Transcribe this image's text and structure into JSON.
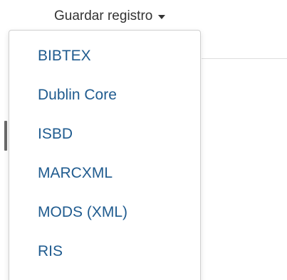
{
  "dropdown": {
    "toggle_label": "Guardar registro",
    "items": [
      {
        "label": "BIBTEX"
      },
      {
        "label": "Dublin Core"
      },
      {
        "label": "ISBD"
      },
      {
        "label": "MARCXML"
      },
      {
        "label": "MODS (XML)"
      },
      {
        "label": "RIS"
      }
    ]
  },
  "colors": {
    "link": "#1f5b8f",
    "toggle_text": "#333333",
    "menu_border": "#d0d0d0"
  },
  "icons": {
    "caret": "caret-down-icon"
  }
}
